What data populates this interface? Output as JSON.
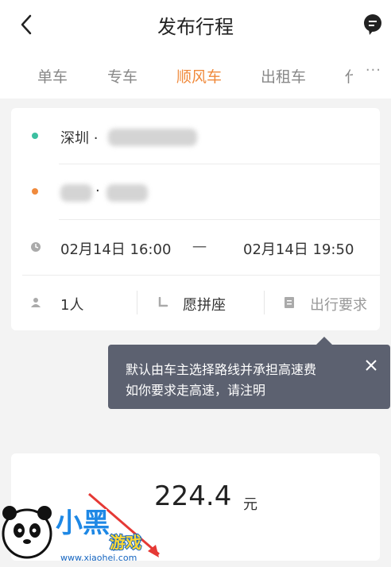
{
  "header": {
    "title": "发布行程"
  },
  "tabs": [
    {
      "label": "单车"
    },
    {
      "label": "专车"
    },
    {
      "label": "顺风车"
    },
    {
      "label": "出租车"
    },
    {
      "label": "代"
    }
  ],
  "tabs_more": "···",
  "route": {
    "from_text": "深圳 ·",
    "to_text": "·",
    "depart_time": "02月14日 16:00",
    "time_sep": "一",
    "arrive_time": "02月14日 19:50"
  },
  "options": {
    "passengers": "1人",
    "carpool": "愿拼座",
    "requirements": "出行要求"
  },
  "tooltip": {
    "line1": "默认由车主选择路线并承担高速费",
    "line2": "如你要求走高速，请注明"
  },
  "price": {
    "amount": "224.4",
    "unit": "元"
  },
  "watermark": {
    "brand": "小黑游戏",
    "url": "www.xiaohei.com"
  },
  "colors": {
    "accent": "#f08a3c",
    "from_dot": "#3cbfa0",
    "to_dot": "#f08a3c",
    "tooltip_bg": "#5c6170"
  }
}
